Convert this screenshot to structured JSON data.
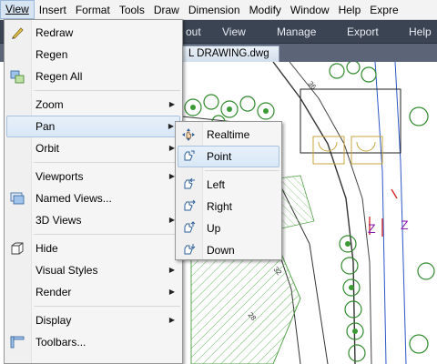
{
  "menubar": {
    "items": [
      {
        "label": "View",
        "active": true
      },
      {
        "label": "Insert"
      },
      {
        "label": "Format"
      },
      {
        "label": "Tools"
      },
      {
        "label": "Draw"
      },
      {
        "label": "Dimension"
      },
      {
        "label": "Modify"
      },
      {
        "label": "Window"
      },
      {
        "label": "Help"
      },
      {
        "label": "Expre"
      }
    ]
  },
  "ribbon": {
    "tabs": [
      "out",
      "View",
      "Manage",
      "Export",
      "Help"
    ]
  },
  "document": {
    "tab_label": "L DRAWING.dwg"
  },
  "view_menu": {
    "items": [
      {
        "label": "Redraw",
        "icon": "redraw-icon"
      },
      {
        "label": "Regen",
        "icon": "none"
      },
      {
        "label": "Regen All",
        "icon": "regen-all-icon"
      },
      {
        "label": "Zoom",
        "submenu": true
      },
      {
        "label": "Pan",
        "submenu": true,
        "highlighted": true
      },
      {
        "label": "Orbit",
        "submenu": true
      },
      {
        "label": "Viewports",
        "submenu": true
      },
      {
        "label": "Named Views...",
        "icon": "named-views-icon"
      },
      {
        "label": "3D Views",
        "submenu": true
      },
      {
        "label": "Hide",
        "icon": "hide-icon"
      },
      {
        "label": "Visual Styles",
        "submenu": true
      },
      {
        "label": "Render",
        "submenu": true
      },
      {
        "label": "Display",
        "submenu": true
      },
      {
        "label": "Toolbars...",
        "icon": "toolbars-icon"
      }
    ]
  },
  "pan_submenu": {
    "items": [
      {
        "label": "Realtime",
        "icon": "pan-realtime-icon"
      },
      {
        "label": "Point",
        "icon": "pan-point-icon",
        "highlighted": true
      },
      {
        "label": "Left",
        "icon": "pan-left-icon"
      },
      {
        "label": "Right",
        "icon": "pan-right-icon"
      },
      {
        "label": "Up",
        "icon": "pan-up-icon"
      },
      {
        "label": "Down",
        "icon": "pan-down-icon"
      }
    ]
  },
  "colors": {
    "menu_bg": "#f5f5f5",
    "highlight": "#d9e7f6",
    "ribbon": "#3b4453"
  }
}
